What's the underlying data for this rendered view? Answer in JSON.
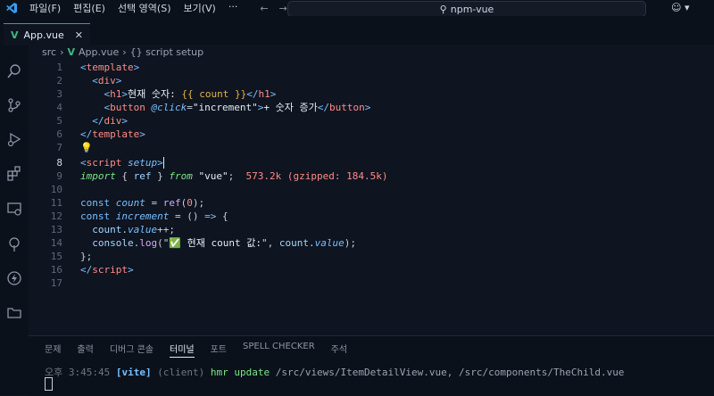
{
  "menu": [
    "파일(F)",
    "편집(E)",
    "선택 영역(S)",
    "보기(V)",
    "···"
  ],
  "search_text": "npm-vue",
  "tab": {
    "label": "App.vue",
    "close": "✕"
  },
  "breadcrumb": {
    "root": "src",
    "file": "App.vue",
    "symbol": "{} script setup"
  },
  "panel_tabs": [
    "문제",
    "출력",
    "디버그 콘솔",
    "터미널",
    "포트",
    "SPELL CHECKER",
    "주석"
  ],
  "active_panel_tab": "터미널",
  "hint_size": "573.2k (gzipped: 184.5k)",
  "terminal": {
    "time": "오후 3:45:45",
    "vite": "[vite]",
    "client": "(client)",
    "msg": "hmr update",
    "paths": "/src/views/ItemDetailView.vue, /src/components/TheChild.vue"
  },
  "line_numbers": [
    "1",
    "2",
    "3",
    "4",
    "5",
    "6",
    "7",
    "8",
    "9",
    "10",
    "11",
    "12",
    "13",
    "14",
    "15",
    "16",
    "17"
  ],
  "code": {
    "l3_text": "현재 숫자: ",
    "l3_expr": "{{ count }}",
    "l4_attr": "@click",
    "l4_val": "\"increment\"",
    "l4_text": "+ 숫자 증가",
    "l13_text": "✅ 현재 count 값:",
    "imp_from": "from",
    "imp_mod": "\"vue\""
  }
}
